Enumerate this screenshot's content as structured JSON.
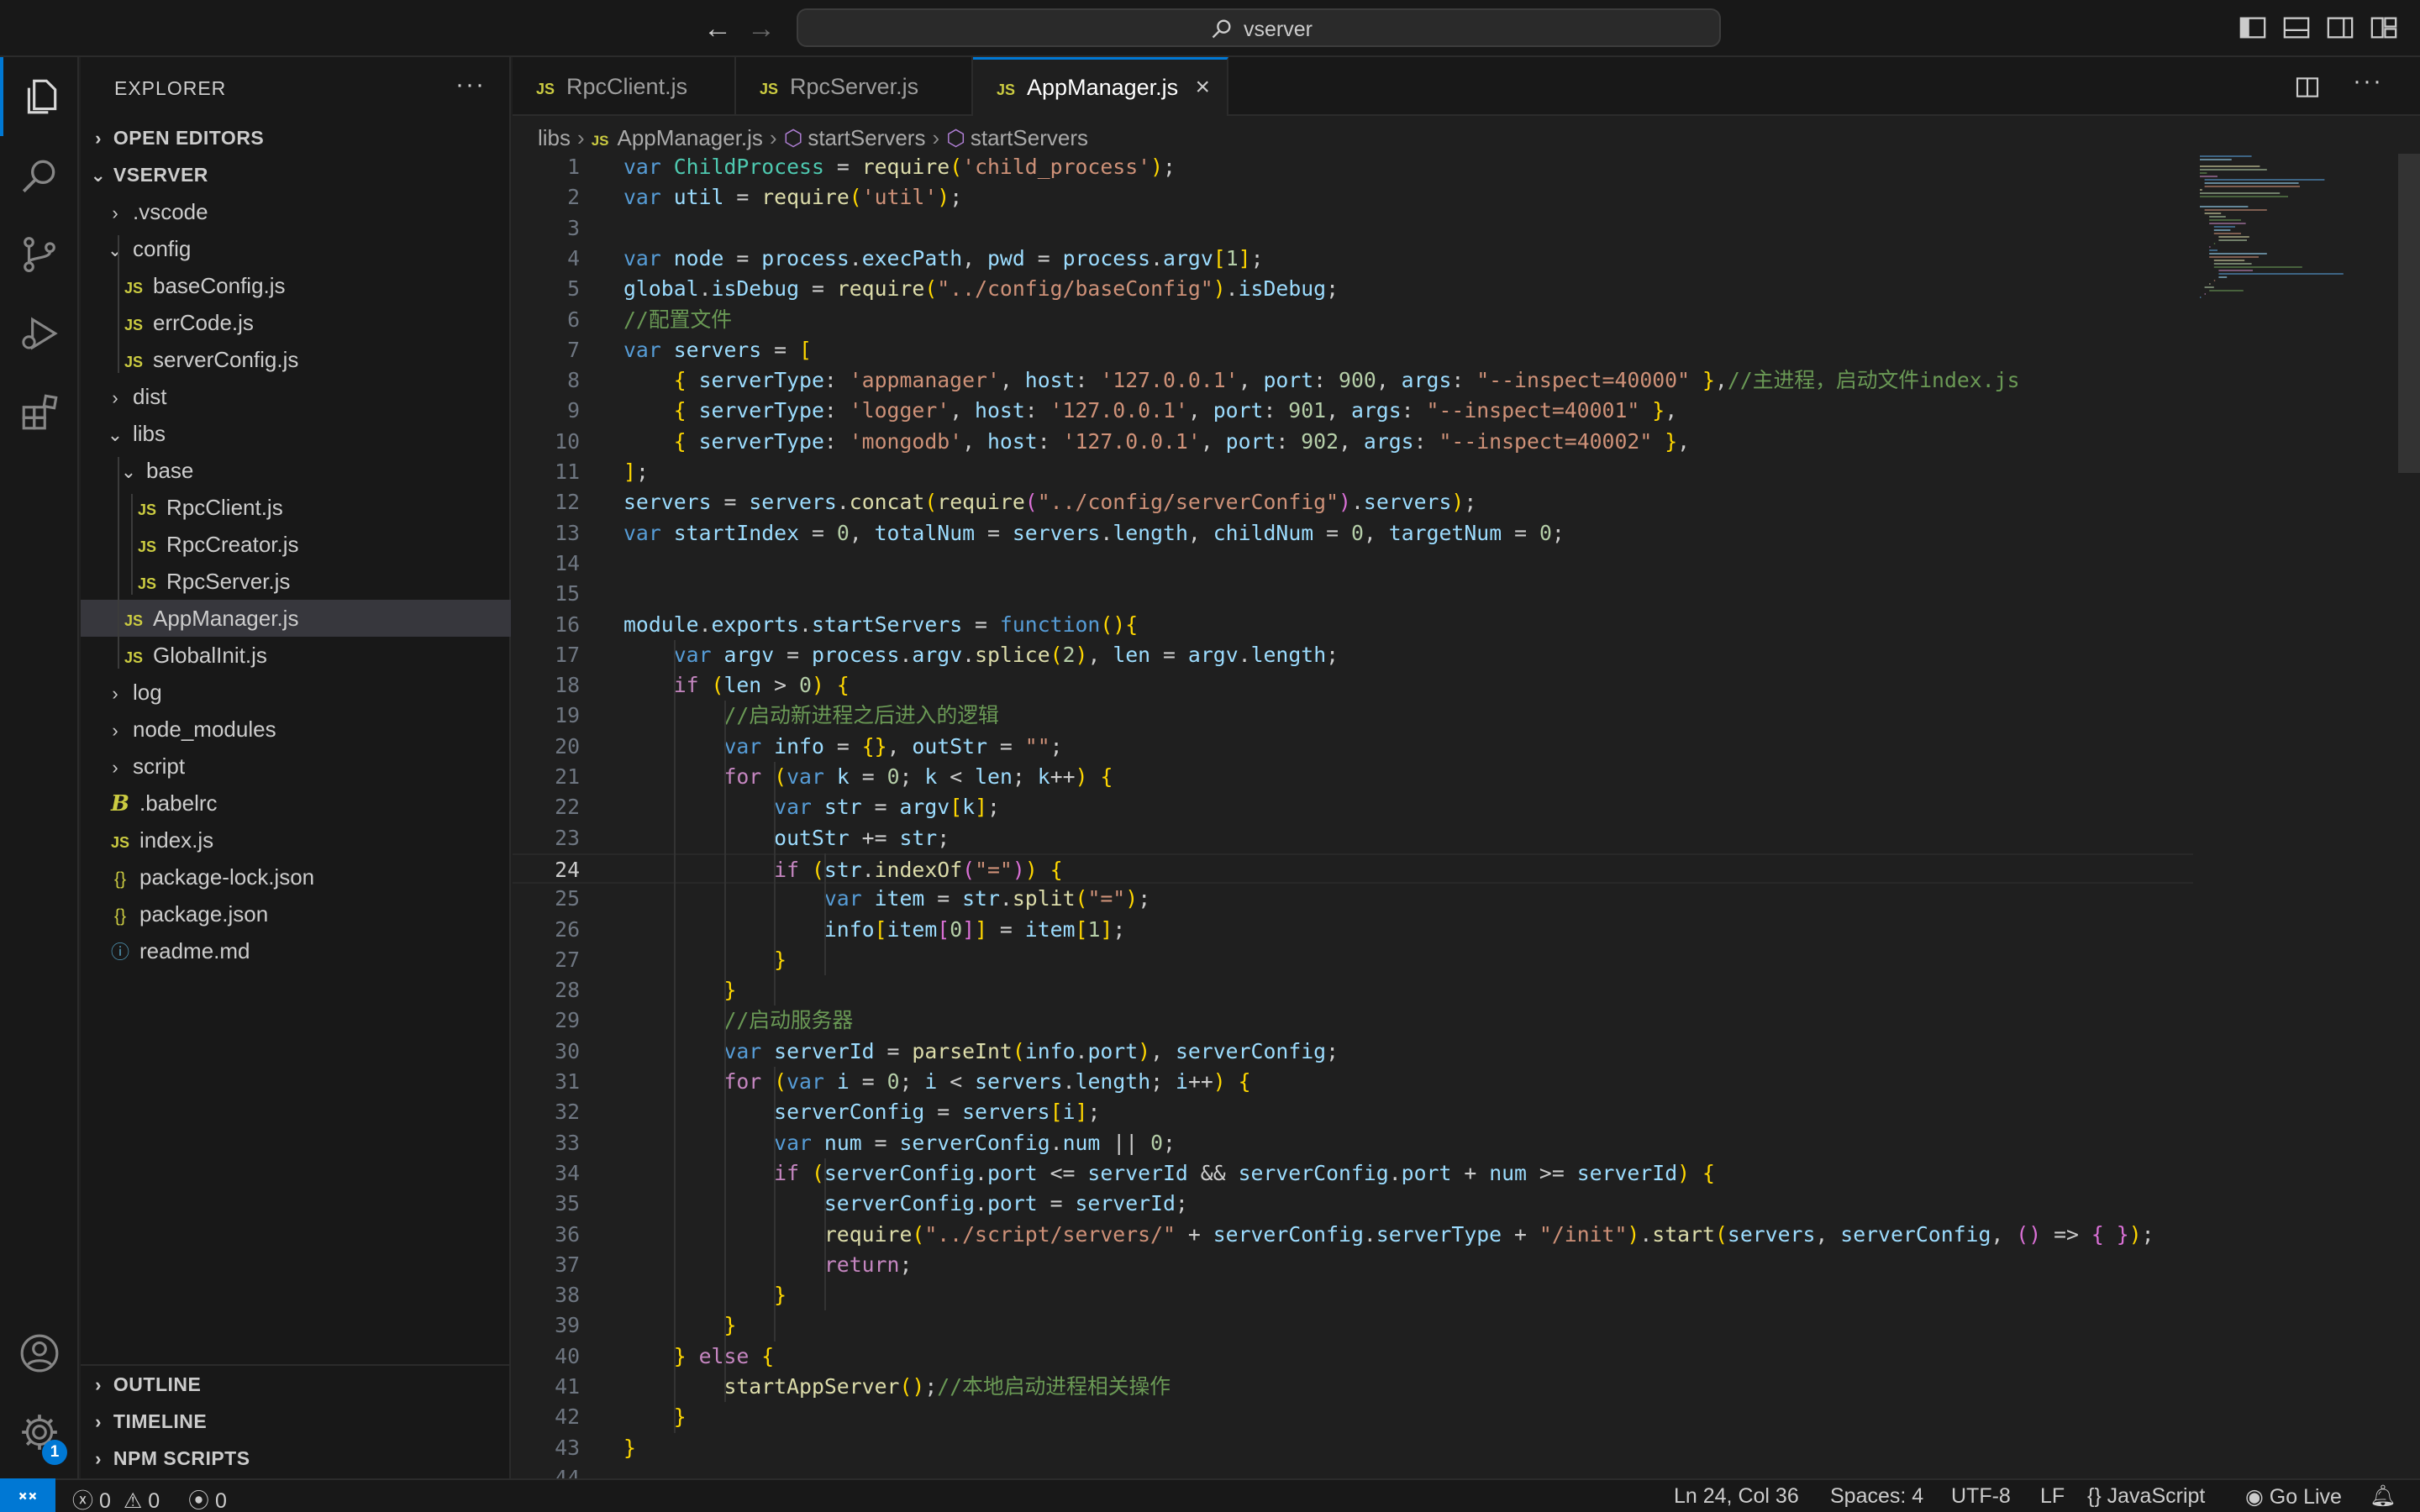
{
  "titlebar": {
    "search_label": "vserver"
  },
  "activitybar": {
    "settings_badge": "1"
  },
  "sidebar": {
    "title": "EXPLORER",
    "more": "···",
    "sections": {
      "open_editors": "OPEN EDITORS",
      "workspace": "VSERVER",
      "outline": "OUTLINE",
      "timeline": "TIMELINE",
      "npm": "NPM SCRIPTS"
    },
    "tree": [
      {
        "label": ".vscode",
        "kind": "folder",
        "open": false,
        "depth": 1
      },
      {
        "label": "config",
        "kind": "folder",
        "open": true,
        "depth": 1
      },
      {
        "label": "baseConfig.js",
        "kind": "js",
        "depth": 2
      },
      {
        "label": "errCode.js",
        "kind": "js",
        "depth": 2
      },
      {
        "label": "serverConfig.js",
        "kind": "js",
        "depth": 2
      },
      {
        "label": "dist",
        "kind": "folder",
        "open": false,
        "depth": 1
      },
      {
        "label": "libs",
        "kind": "folder",
        "open": true,
        "depth": 1
      },
      {
        "label": "base",
        "kind": "folder",
        "open": true,
        "depth": 2
      },
      {
        "label": "RpcClient.js",
        "kind": "js",
        "depth": 3
      },
      {
        "label": "RpcCreator.js",
        "kind": "js",
        "depth": 3
      },
      {
        "label": "RpcServer.js",
        "kind": "js",
        "depth": 3
      },
      {
        "label": "AppManager.js",
        "kind": "js",
        "depth": 2,
        "selected": true
      },
      {
        "label": "GlobalInit.js",
        "kind": "js",
        "depth": 2
      },
      {
        "label": "log",
        "kind": "folder",
        "open": false,
        "depth": 1
      },
      {
        "label": "node_modules",
        "kind": "folder",
        "open": false,
        "depth": 1
      },
      {
        "label": "script",
        "kind": "folder",
        "open": false,
        "depth": 1
      },
      {
        "label": ".babelrc",
        "kind": "babel",
        "depth": 1
      },
      {
        "label": "index.js",
        "kind": "js",
        "depth": 1
      },
      {
        "label": "package-lock.json",
        "kind": "json",
        "depth": 1
      },
      {
        "label": "package.json",
        "kind": "json",
        "depth": 1
      },
      {
        "label": "readme.md",
        "kind": "info",
        "depth": 1
      }
    ]
  },
  "tabs": [
    {
      "label": "RpcClient.js",
      "active": false
    },
    {
      "label": "RpcServer.js",
      "active": false
    },
    {
      "label": "AppManager.js",
      "active": true
    }
  ],
  "breadcrumb": {
    "folder": "libs",
    "file": "AppManager.js",
    "sym1": "startServers",
    "sym2": "startServers"
  },
  "editor": {
    "current_line": 24,
    "lines": [
      "var ChildProcess = require('child_process');",
      "var util = require('util');",
      "",
      "var node = process.execPath, pwd = process.argv[1];",
      "global.isDebug = require(\"../config/baseConfig\").isDebug;",
      "//配置文件",
      "var servers = [",
      "    { serverType: 'appmanager', host: '127.0.0.1', port: 900, args: \"--inspect=40000\" },//主进程，启动文件index.js",
      "    { serverType: 'logger', host: '127.0.0.1', port: 901, args: \"--inspect=40001\" },",
      "    { serverType: 'mongodb', host: '127.0.0.1', port: 902, args: \"--inspect=40002\" },",
      "];",
      "servers = servers.concat(require(\"../config/serverConfig\").servers);",
      "var startIndex = 0, totalNum = servers.length, childNum = 0, targetNum = 0;",
      "",
      "",
      "module.exports.startServers = function(){",
      "    var argv = process.argv.splice(2), len = argv.length;",
      "    if (len > 0) {",
      "        //启动新进程之后进入的逻辑",
      "        var info = {}, outStr = \"\";",
      "        for (var k = 0; k < len; k++) {",
      "            var str = argv[k];",
      "            outStr += str;",
      "            if (str.indexOf(\"=\")) {",
      "                var item = str.split(\"=\");",
      "                info[item[0]] = item[1];",
      "            }",
      "        }",
      "        //启动服务器",
      "        var serverId = parseInt(info.port), serverConfig;",
      "        for (var i = 0; i < servers.length; i++) {",
      "            serverConfig = servers[i];",
      "            var num = serverConfig.num || 0;",
      "            if (serverConfig.port <= serverId && serverConfig.port + num >= serverId) {",
      "                serverConfig.port = serverId;",
      "                require(\"../script/servers/\" + serverConfig.serverType + \"/init\").start(servers, serverConfig, () => { });",
      "                return;",
      "            }",
      "        }",
      "    } else {",
      "        startAppServer();//本地启动进程相关操作",
      "    }",
      "}",
      ""
    ]
  },
  "statusbar": {
    "errors": "0",
    "warnings": "0",
    "ports": "0",
    "position": "Ln 24, Col 36",
    "spaces": "Spaces: 4",
    "encoding": "UTF-8",
    "eol": "LF",
    "language": "JavaScript",
    "golive": "Go Live"
  },
  "colors": {
    "accent": "#0078d4",
    "bg": "#1f1f1f",
    "panel": "#181818",
    "js_icon": "#cbcb41"
  }
}
